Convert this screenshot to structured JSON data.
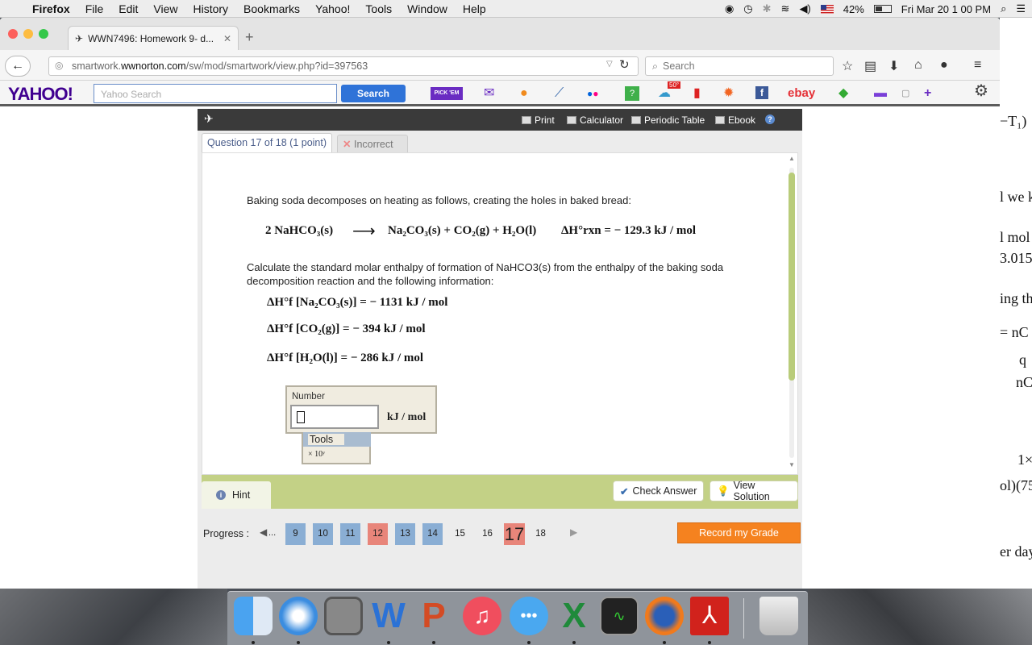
{
  "menubar": {
    "app": "Firefox",
    "items": [
      "File",
      "Edit",
      "View",
      "History",
      "Bookmarks",
      "Yahoo!",
      "Tools",
      "Window",
      "Help"
    ],
    "battery": "42%",
    "clock": "Fri Mar 20  1 00 PM"
  },
  "browser": {
    "tab_title": "WWN7496: Homework 9- d...",
    "url_prefix": "smartwork.",
    "url_host": "wwnorton.com",
    "url_path": "/sw/mod/smartwork/view.php?id=397563",
    "search_placeholder": "Search"
  },
  "yahoo_toolbar": {
    "logo": "YAHOO!",
    "search_placeholder": "Yahoo Search",
    "search_button": "Search",
    "pick_em": "PICK 'EM",
    "ebay": "ebay",
    "badge": "50°"
  },
  "frame_header": {
    "print": "Print",
    "calculator": "Calculator",
    "periodic_table": "Periodic Table",
    "ebook": "Ebook",
    "help": "?"
  },
  "question": {
    "tab_label": "Question 17 of 18 (1 point)",
    "status_label": "Incorrect",
    "intro": "Baking soda decomposes on heating as follows, creating the holes in baked bread:",
    "reaction_left": "2  NaHCO₃(s)",
    "arrow": "⟶",
    "reaction_right": "Na₂CO₃(s) + CO₂(g) + H₂O(l)",
    "reaction_dh": "ΔH°rxn = − 129.3  kJ / mol",
    "prompt": "Calculate the standard molar enthalpy of formation of NaHCO3(s) from the enthalpy of the baking soda decomposition reaction and the following information:",
    "data_lines": [
      "ΔH°f [Na₂CO₃(s)] = − 1131  kJ / mol",
      "ΔH°f [CO₂(g)] = − 394  kJ / mol",
      "ΔH°f [H₂O(l)] = − 286  kJ / mol"
    ],
    "answer_label": "Number",
    "answer_value": "",
    "answer_unit": "kJ / mol",
    "tools_label": "Tools",
    "tools_item": "× 10ʸ"
  },
  "actions": {
    "hint": "Hint",
    "check_answer": "Check Answer",
    "view_solution": "View Solution"
  },
  "progress": {
    "label": "Progress :",
    "ellipsis": "...",
    "pages": [
      {
        "n": "9",
        "state": "blue"
      },
      {
        "n": "10",
        "state": "blue"
      },
      {
        "n": "11",
        "state": "blue"
      },
      {
        "n": "12",
        "state": "red"
      },
      {
        "n": "13",
        "state": "blue"
      },
      {
        "n": "14",
        "state": "blue"
      },
      {
        "n": "15",
        "state": "plain"
      },
      {
        "n": "16",
        "state": "plain"
      },
      {
        "n": "17",
        "state": "current"
      },
      {
        "n": "18",
        "state": "plain"
      }
    ],
    "record_button": "Record my Grade"
  },
  "background_page_fragments": [
    "−T₁)",
    "l we k",
    "l mol",
    "3.015",
    "ing th",
    "=  nC",
    "q",
    "nC",
    "1×",
    "ol)(75",
    "er day"
  ],
  "colors": {
    "accent_green": "#c3d186",
    "progress_blue": "#8aaed4",
    "progress_red": "#e8857a",
    "record_orange": "#f5821f"
  }
}
